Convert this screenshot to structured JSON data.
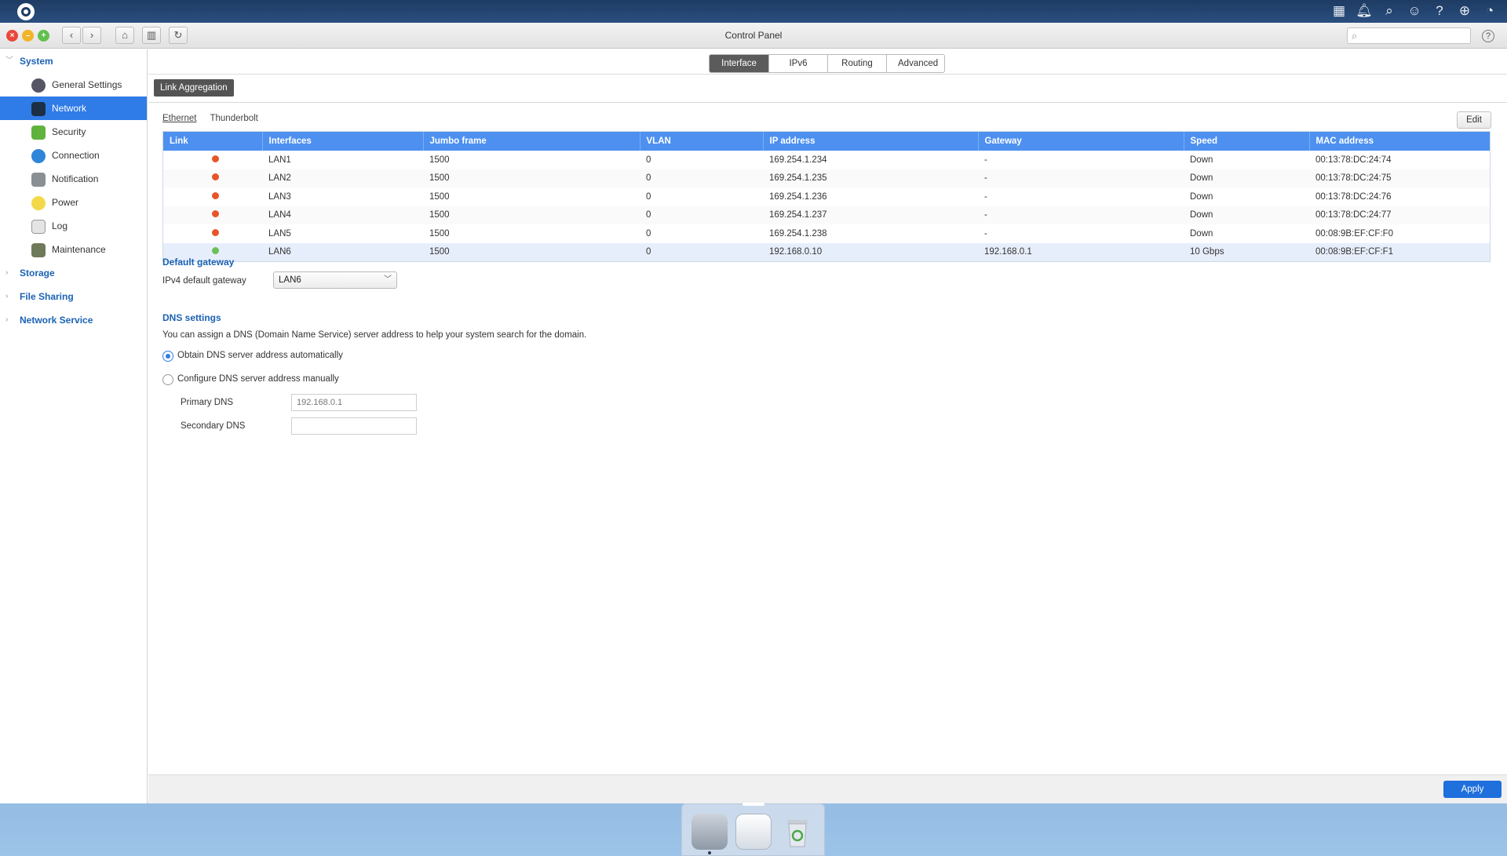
{
  "window": {
    "title": "Control Panel",
    "search_placeholder": ""
  },
  "sidebar": {
    "groups": [
      {
        "label": "System",
        "items": [
          {
            "label": "General Settings",
            "icon": "gear-icon"
          },
          {
            "label": "Network",
            "icon": "network-icon",
            "active": true
          },
          {
            "label": "Security",
            "icon": "lock-icon"
          },
          {
            "label": "Connection",
            "icon": "globe-icon"
          },
          {
            "label": "Notification",
            "icon": "bell-icon"
          },
          {
            "label": "Power",
            "icon": "bulb-icon"
          },
          {
            "label": "Log",
            "icon": "log-icon"
          },
          {
            "label": "Maintenance",
            "icon": "tools-icon"
          }
        ]
      },
      {
        "label": "Storage"
      },
      {
        "label": "File Sharing"
      },
      {
        "label": "Network Service"
      }
    ]
  },
  "tabs": [
    "Interface",
    "IPv6",
    "Routing",
    "Advanced"
  ],
  "link_aggregation_label": "Link Aggregation",
  "subtabs": [
    "Ethernet",
    "Thunderbolt"
  ],
  "edit_label": "Edit",
  "table": {
    "columns": [
      "Link",
      "Interfaces",
      "Jumbo frame",
      "VLAN",
      "IP address",
      "Gateway",
      "Speed",
      "MAC address"
    ],
    "rows": [
      {
        "link": "down",
        "interface": "LAN1",
        "jumbo": "1500",
        "vlan": "0",
        "ip": "169.254.1.234",
        "gateway": "-",
        "speed": "Down",
        "mac": "00:13:78:DC:24:74"
      },
      {
        "link": "down",
        "interface": "LAN2",
        "jumbo": "1500",
        "vlan": "0",
        "ip": "169.254.1.235",
        "gateway": "-",
        "speed": "Down",
        "mac": "00:13:78:DC:24:75"
      },
      {
        "link": "down",
        "interface": "LAN3",
        "jumbo": "1500",
        "vlan": "0",
        "ip": "169.254.1.236",
        "gateway": "-",
        "speed": "Down",
        "mac": "00:13:78:DC:24:76"
      },
      {
        "link": "down",
        "interface": "LAN4",
        "jumbo": "1500",
        "vlan": "0",
        "ip": "169.254.1.237",
        "gateway": "-",
        "speed": "Down",
        "mac": "00:13:78:DC:24:77"
      },
      {
        "link": "down",
        "interface": "LAN5",
        "jumbo": "1500",
        "vlan": "0",
        "ip": "169.254.1.238",
        "gateway": "-",
        "speed": "Down",
        "mac": "00:08:9B:EF:CF:F0"
      },
      {
        "link": "up",
        "interface": "LAN6",
        "jumbo": "1500",
        "vlan": "0",
        "ip": "192.168.0.10",
        "gateway": "192.168.0.1",
        "speed": "10 Gbps",
        "mac": "00:08:9B:EF:CF:F1"
      }
    ]
  },
  "default_gateway": {
    "title": "Default gateway",
    "label": "IPv4 default gateway",
    "value": "LAN6"
  },
  "dns": {
    "title": "DNS settings",
    "description": "You can assign a DNS (Domain Name Service) server address to help your system search for the domain.",
    "auto_label": "Obtain DNS server address automatically",
    "manual_label": "Configure DNS server address manually",
    "primary_label": "Primary DNS",
    "primary_placeholder": "192.168.0.1",
    "secondary_label": "Secondary DNS",
    "secondary_value": ""
  },
  "apply_label": "Apply",
  "colors": {
    "accent": "#2f7ce8",
    "link_down": "#e8552a",
    "link_up": "#6cc05a",
    "header": "#4d90f0"
  }
}
